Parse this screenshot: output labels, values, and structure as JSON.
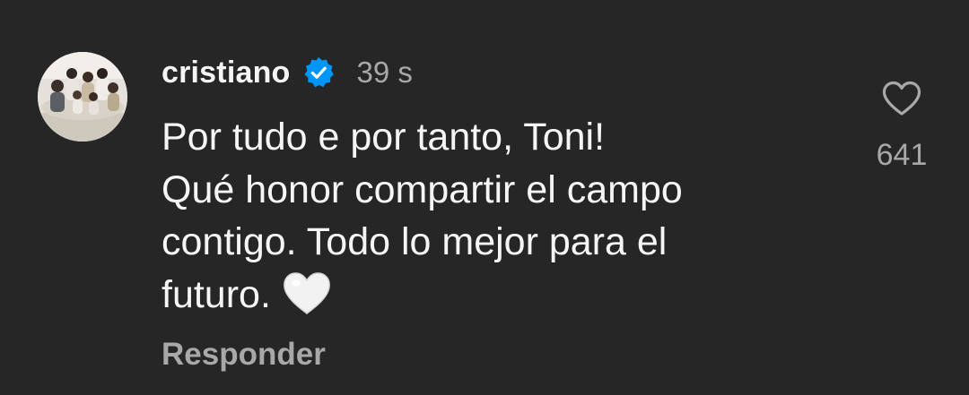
{
  "comment": {
    "username": "cristiano",
    "verified_icon": "verified-badge-icon",
    "timestamp": "39 s",
    "text_lines": [
      "Por tudo e por tanto, Toni!",
      "Qué honor compartir el campo",
      "contigo. Todo lo mejor para el",
      "futuro."
    ],
    "emoji_icon": "white-heart-emoji-icon",
    "reply_label": "Responder",
    "like_icon": "heart-outline-icon",
    "like_count": "641"
  },
  "colors": {
    "background": "#262626",
    "primary_text": "#f5f5f5",
    "secondary_text": "#a8a8a8",
    "verified_blue": "#0095f6"
  }
}
